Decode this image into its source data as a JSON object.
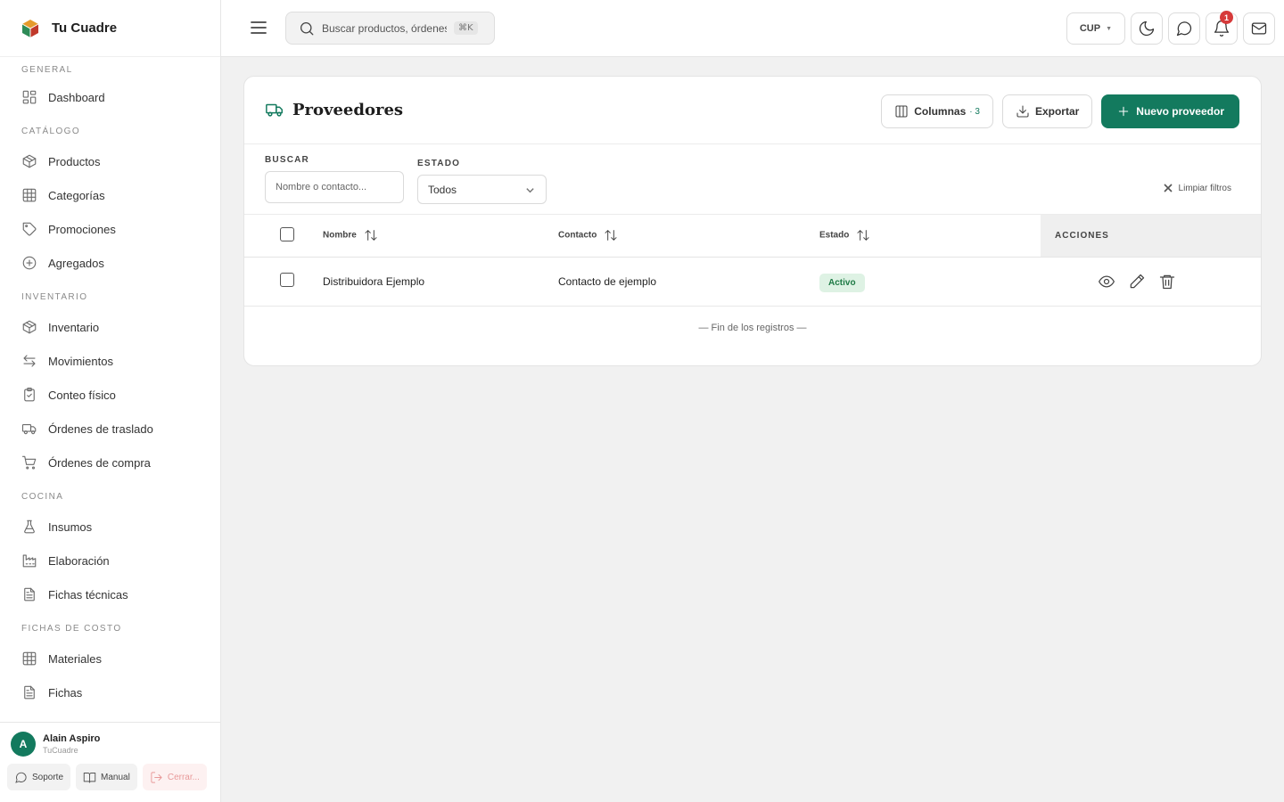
{
  "brand": {
    "name": "Tu Cuadre"
  },
  "sidebar": {
    "sections": [
      {
        "label": "GENERAL",
        "items": [
          {
            "label": "Dashboard",
            "icon": "dashboard-icon"
          }
        ]
      },
      {
        "label": "CATÁLOGO",
        "items": [
          {
            "label": "Productos",
            "icon": "box-icon"
          },
          {
            "label": "Categorías",
            "icon": "grid-icon"
          },
          {
            "label": "Promociones",
            "icon": "tag-icon"
          },
          {
            "label": "Agregados",
            "icon": "plus-circle-icon"
          }
        ]
      },
      {
        "label": "INVENTARIO",
        "items": [
          {
            "label": "Inventario",
            "icon": "box-icon"
          },
          {
            "label": "Movimientos",
            "icon": "arrows-icon"
          },
          {
            "label": "Conteo físico",
            "icon": "clipboard-check-icon"
          },
          {
            "label": "Órdenes de traslado",
            "icon": "truck-icon"
          },
          {
            "label": "Órdenes de compra",
            "icon": "cart-icon"
          }
        ]
      },
      {
        "label": "COCINA",
        "items": [
          {
            "label": "Insumos",
            "icon": "flask-icon"
          },
          {
            "label": "Elaboración",
            "icon": "factory-icon"
          },
          {
            "label": "Fichas técnicas",
            "icon": "document-icon"
          }
        ]
      },
      {
        "label": "FICHAS DE COSTO",
        "items": [
          {
            "label": "Materiales",
            "icon": "grid-icon"
          },
          {
            "label": "Fichas",
            "icon": "document-icon"
          }
        ]
      }
    ],
    "user": {
      "initial": "A",
      "name": "Alain Aspiro",
      "org": "TuCuadre"
    },
    "footer": {
      "support": "Soporte",
      "manual": "Manual",
      "logout": "Cerrar..."
    }
  },
  "topbar": {
    "search_placeholder": "Buscar productos, órdenes...",
    "shortcut": "⌘K",
    "currency": "CUP",
    "notifications_count": "1"
  },
  "page": {
    "title": "Proveedores",
    "columns_label": "Columnas",
    "columns_count": "· 3",
    "export_label": "Exportar",
    "new_label": "Nuevo proveedor"
  },
  "filters": {
    "search_label": "BUSCAR",
    "search_placeholder": "Nombre o contacto...",
    "status_label": "ESTADO",
    "status_value": "Todos",
    "clear_label": "Limpiar filtros"
  },
  "table": {
    "headers": {
      "name": "Nombre",
      "contact": "Contacto",
      "status": "Estado",
      "actions": "ACCIONES"
    },
    "rows": [
      {
        "name": "Distribuidora Ejemplo",
        "contact": "Contacto de ejemplo",
        "status": "Activo"
      }
    ],
    "end_note": "— Fin de los registros —"
  },
  "colors": {
    "accent": "#137a5e",
    "danger": "#d63a3a",
    "status_active_bg": "#def2e4"
  }
}
